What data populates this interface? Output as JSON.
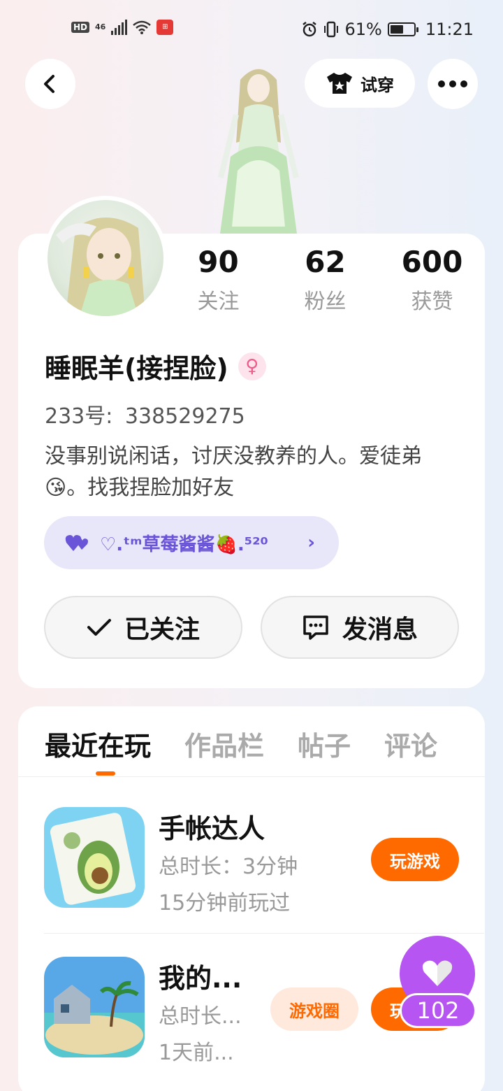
{
  "status_bar": {
    "hd": "HD",
    "network": "46",
    "battery_percent": "61%",
    "battery_level": 0.61,
    "time": "11:21"
  },
  "nav": {
    "back_icon": "chevron-left-icon",
    "try_on_label": "试穿",
    "more_icon": "more-dots-icon"
  },
  "profile": {
    "stats": [
      {
        "value": "90",
        "label": "关注"
      },
      {
        "value": "62",
        "label": "粉丝"
      },
      {
        "value": "600",
        "label": "获赞"
      }
    ],
    "username": "睡眠羊(接捏脸)",
    "gender_symbol": "♀",
    "uid_label": "233号:",
    "uid_value": "338529275",
    "bio": "没事别说闲话，讨厌没教养的人。爱徒弟😘。找我捏脸加好友",
    "guild": {
      "name": "♡.ᵗᵐ草莓酱酱🍓.⁵²⁰",
      "chevron": "›"
    },
    "follow_button": "已关注",
    "message_button": "发消息"
  },
  "tabs": [
    "最近在玩",
    "作品栏",
    "帖子",
    "评论"
  ],
  "games": [
    {
      "title": "手帐达人",
      "duration": "总时长：3分钟",
      "last_played": "15分钟前玩过",
      "play_label": "玩游戏"
    },
    {
      "title": "我的...",
      "duration": "总时长...",
      "last_played": "1天前...",
      "circle_label": "游戏圈",
      "play_label": "玩游戏"
    }
  ],
  "like": {
    "count": "102"
  },
  "colors": {
    "accent_orange": "#ff6a00",
    "like_purple": "#b655f2",
    "guild_purple": "#6a55d8"
  }
}
